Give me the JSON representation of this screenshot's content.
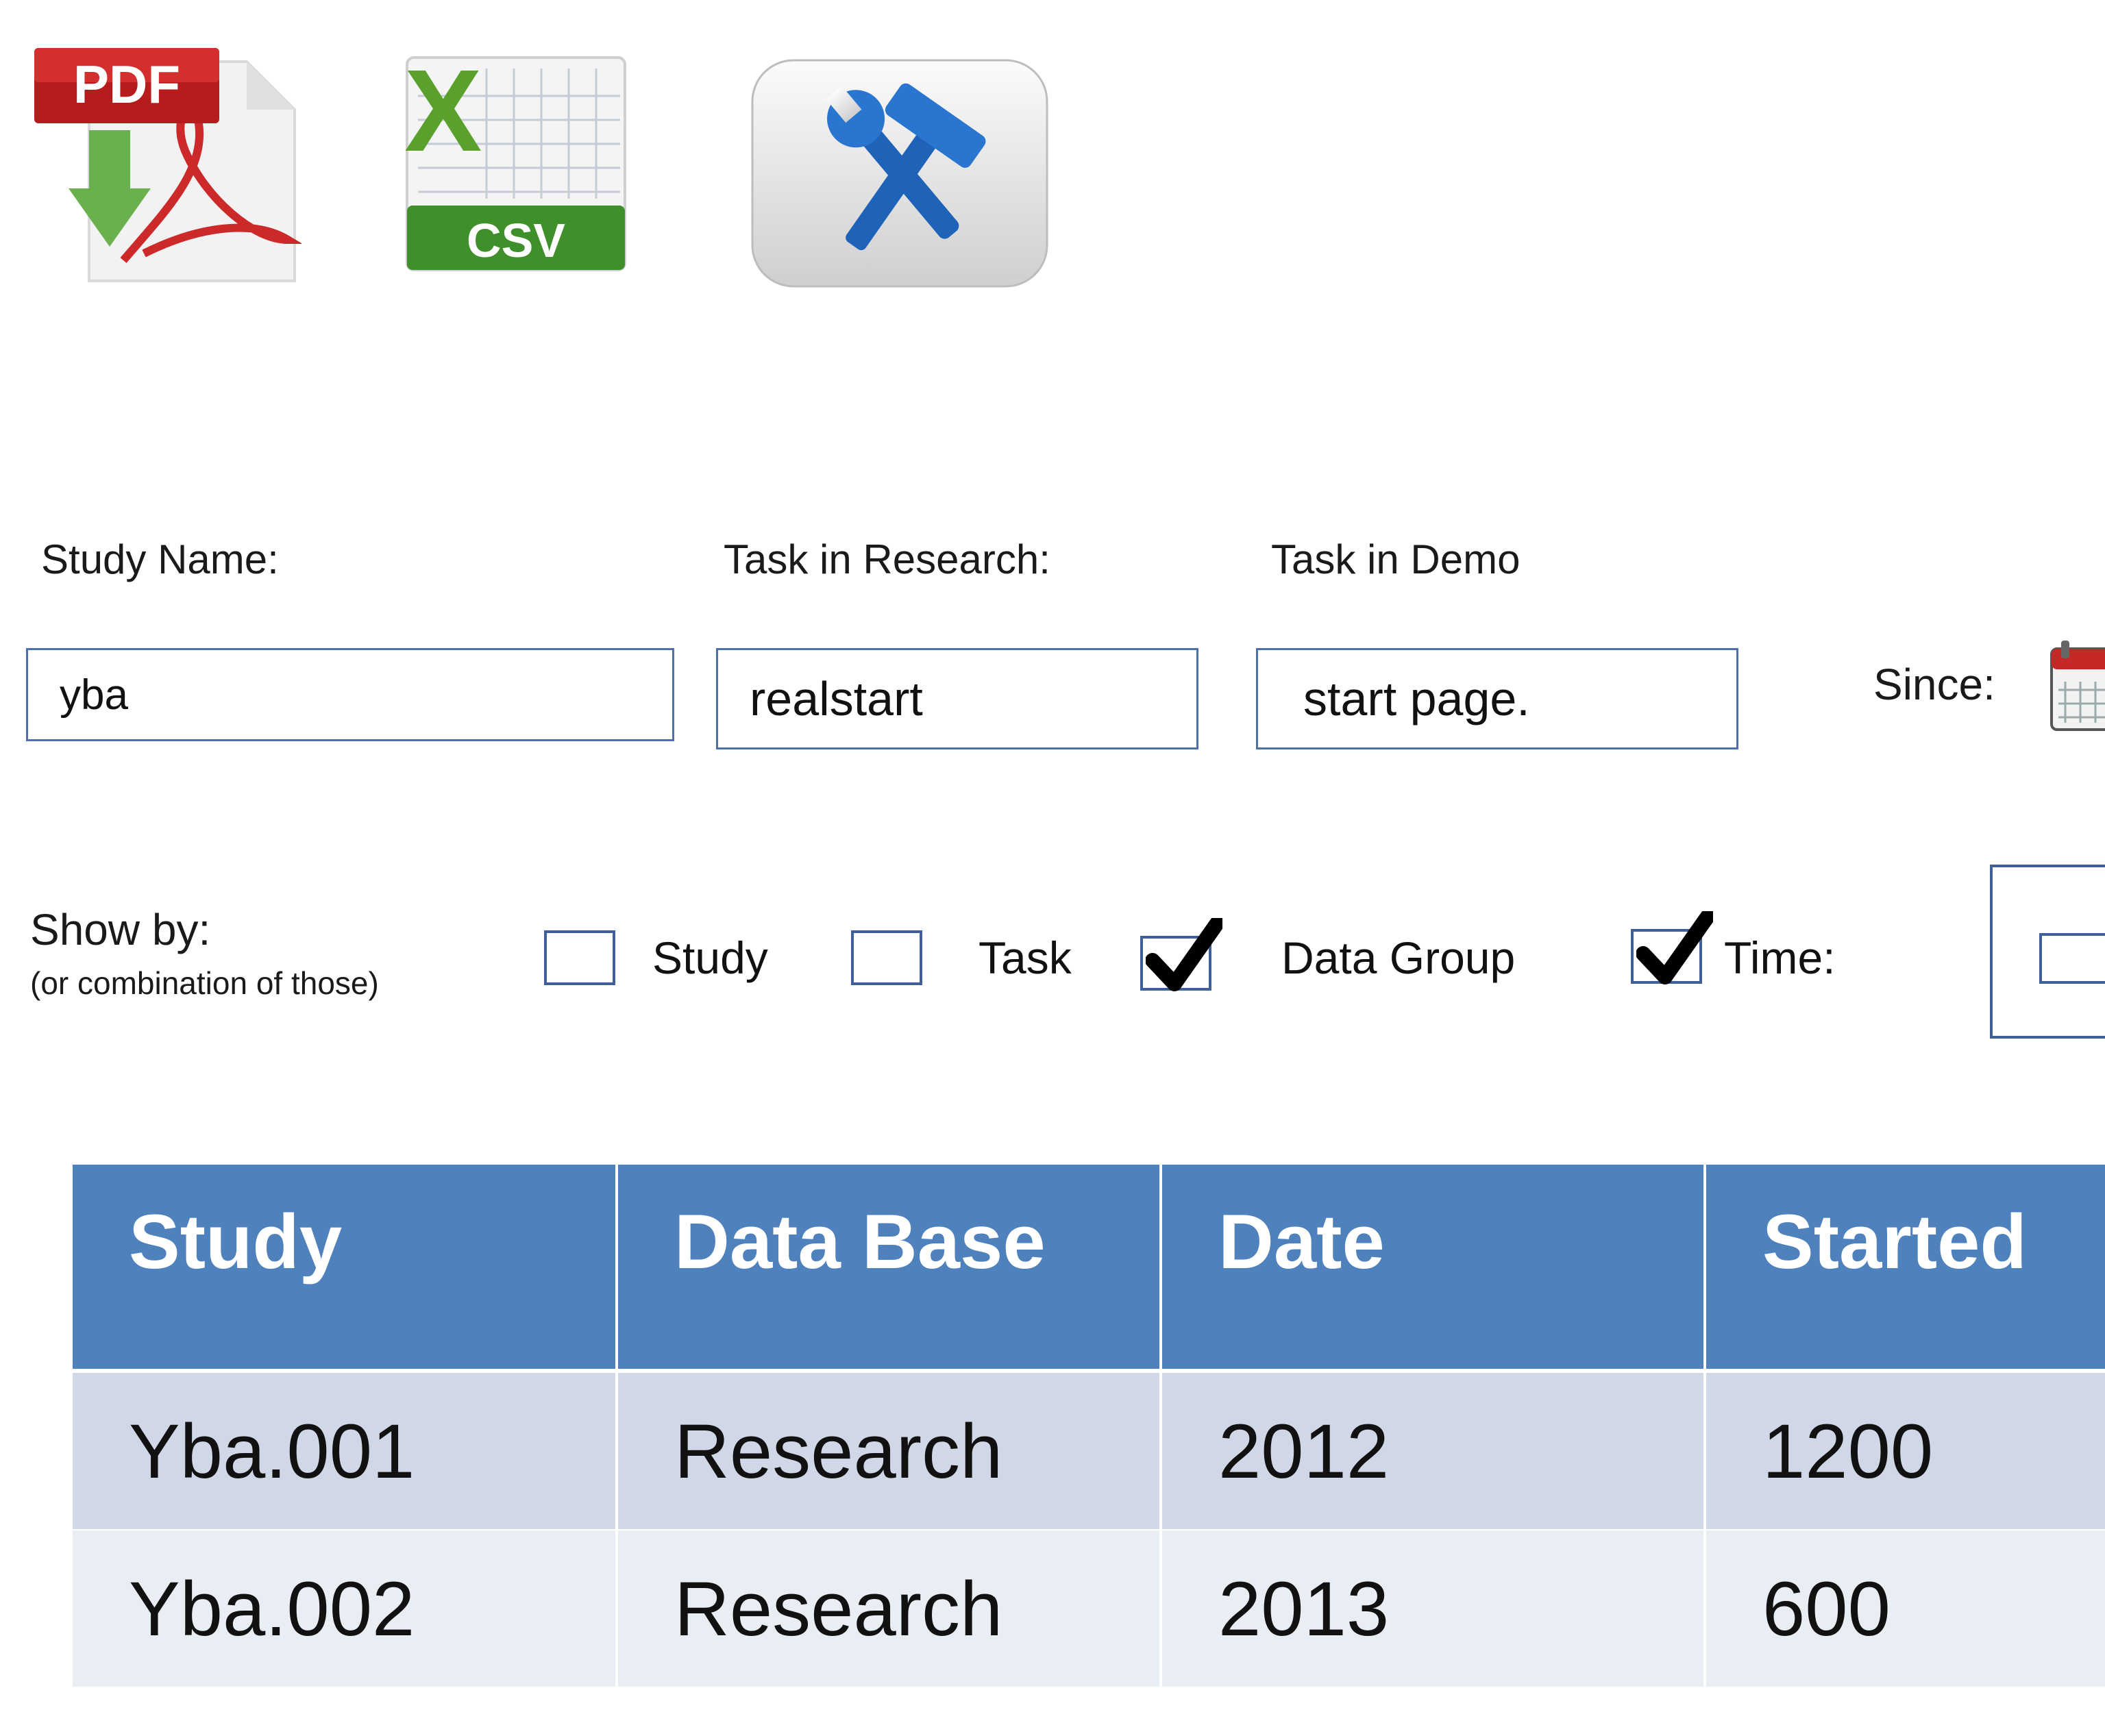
{
  "toolbar": {
    "pdf_label": "PDF",
    "csv_label": "CSV",
    "pdf_icon": "pdf-download-icon",
    "csv_icon": "excel-csv-icon",
    "tools_icon": "tools-icon"
  },
  "filters": {
    "study_name_label": "Study Name:",
    "study_name_value": "yba",
    "task_research_label": "Task in Research:",
    "task_research_value": "realstart",
    "task_demo_label": "Task in Demo",
    "task_demo_value": "start page.",
    "since_label": "Since:",
    "since_icon": "calendar-icon"
  },
  "show_by": {
    "label": "Show by:",
    "sublabel": "(or combination of those)",
    "options": [
      {
        "label": "Study",
        "checked": false
      },
      {
        "label": "Task",
        "checked": false
      },
      {
        "label": "Data Group",
        "checked": true
      },
      {
        "label": "Time:",
        "checked": true
      }
    ]
  },
  "table": {
    "headers": [
      "Study",
      "Data Base",
      "Date",
      "Started"
    ],
    "rows": [
      [
        "Yba.001",
        "Research",
        "2012",
        "1200"
      ],
      [
        "Yba.002",
        "Research",
        "2013",
        "600"
      ]
    ]
  },
  "colors": {
    "header_bg": "#4f81bd",
    "row_odd": "#d0d8e8",
    "row_even": "#e9edf4",
    "field_border": "#4f6fa8"
  }
}
